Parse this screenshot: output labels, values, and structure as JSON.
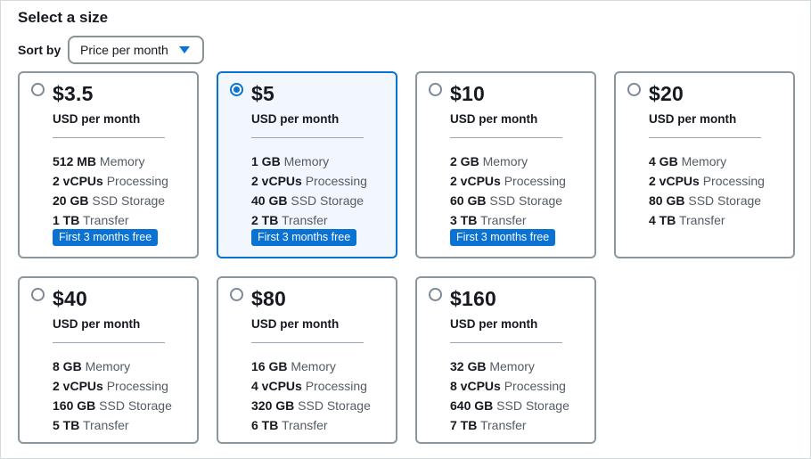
{
  "section": {
    "title": "Select a size",
    "sort_label": "Sort by",
    "sort_value": "Price per month"
  },
  "plans": [
    {
      "price": "$3.5",
      "unit": "USD per month",
      "selected": false,
      "memory": "512 MB",
      "memory_label": "Memory",
      "vcpus": "2 vCPUs",
      "vcpus_label": "Processing",
      "storage": "20 GB",
      "storage_label": "SSD Storage",
      "transfer": "1 TB",
      "transfer_label": "Transfer",
      "badge": "First 3 months free"
    },
    {
      "price": "$5",
      "unit": "USD per month",
      "selected": true,
      "memory": "1 GB",
      "memory_label": "Memory",
      "vcpus": "2 vCPUs",
      "vcpus_label": "Processing",
      "storage": "40 GB",
      "storage_label": "SSD Storage",
      "transfer": "2 TB",
      "transfer_label": "Transfer",
      "badge": "First 3 months free"
    },
    {
      "price": "$10",
      "unit": "USD per month",
      "selected": false,
      "memory": "2 GB",
      "memory_label": "Memory",
      "vcpus": "2 vCPUs",
      "vcpus_label": "Processing",
      "storage": "60 GB",
      "storage_label": "SSD Storage",
      "transfer": "3 TB",
      "transfer_label": "Transfer",
      "badge": "First 3 months free"
    },
    {
      "price": "$20",
      "unit": "USD per month",
      "selected": false,
      "memory": "4 GB",
      "memory_label": "Memory",
      "vcpus": "2 vCPUs",
      "vcpus_label": "Processing",
      "storage": "80 GB",
      "storage_label": "SSD Storage",
      "transfer": "4 TB",
      "transfer_label": "Transfer"
    },
    {
      "price": "$40",
      "unit": "USD per month",
      "selected": false,
      "memory": "8 GB",
      "memory_label": "Memory",
      "vcpus": "2 vCPUs",
      "vcpus_label": "Processing",
      "storage": "160 GB",
      "storage_label": "SSD Storage",
      "transfer": "5 TB",
      "transfer_label": "Transfer"
    },
    {
      "price": "$80",
      "unit": "USD per month",
      "selected": false,
      "memory": "16 GB",
      "memory_label": "Memory",
      "vcpus": "4 vCPUs",
      "vcpus_label": "Processing",
      "storage": "320 GB",
      "storage_label": "SSD Storage",
      "transfer": "6 TB",
      "transfer_label": "Transfer"
    },
    {
      "price": "$160",
      "unit": "USD per month",
      "selected": false,
      "memory": "32 GB",
      "memory_label": "Memory",
      "vcpus": "8 vCPUs",
      "vcpus_label": "Processing",
      "storage": "640 GB",
      "storage_label": "SSD Storage",
      "transfer": "7 TB",
      "transfer_label": "Transfer"
    }
  ],
  "icons": {
    "sort_dropdown": "caret-down-icon",
    "plan_selector": "radio-button"
  },
  "colors": {
    "accent": "#0972d3",
    "selected_card_bg": "#f1f7fd",
    "card_border": "#8c979d",
    "text": "#16191f",
    "muted_text": "#545b64"
  }
}
